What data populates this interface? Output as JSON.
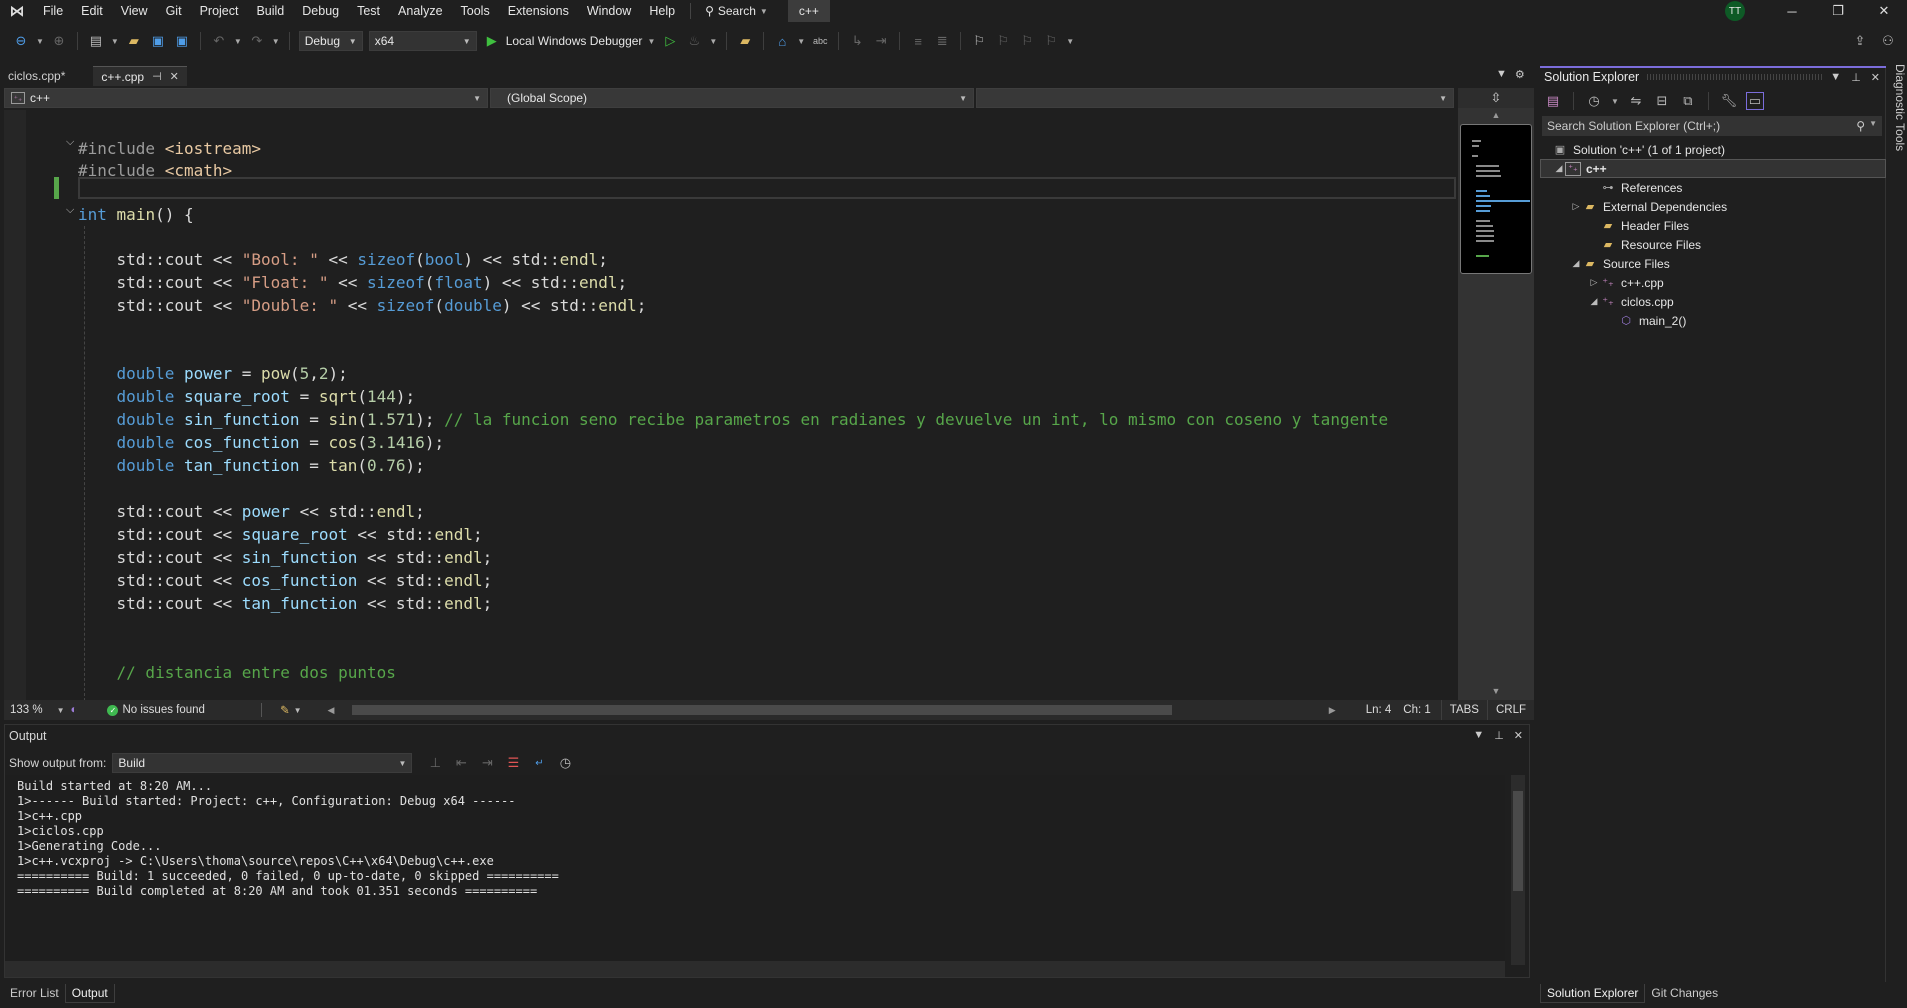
{
  "menubar": {
    "items": [
      "File",
      "Edit",
      "View",
      "Git",
      "Project",
      "Build",
      "Debug",
      "Test",
      "Analyze",
      "Tools",
      "Extensions",
      "Window",
      "Help"
    ],
    "search_label": "Search",
    "solution_name": "c++",
    "avatar_initials": "TT"
  },
  "toolbar": {
    "configuration": "Debug",
    "platform": "x64",
    "debugger_label": "Local Windows Debugger"
  },
  "doc_tabs": [
    {
      "label": "ciclos.cpp*",
      "active": false
    },
    {
      "label": "c++.cpp",
      "active": true
    }
  ],
  "navbar": {
    "project": "c++",
    "scope": "(Global Scope)",
    "member": ""
  },
  "editor": {
    "lines": [
      "#include <iostream>",
      "#include <cmath>",
      "",
      "int main() {",
      "",
      "    std::cout << \"Bool: \" << sizeof(bool) << std::endl;",
      "    std::cout << \"Float: \" << sizeof(float) << std::endl;",
      "    std::cout << \"Double: \" << sizeof(double) << std::endl;",
      "",
      "",
      "    double power = pow(5,2);",
      "    double square_root = sqrt(144);",
      "    double sin_function = sin(1.571); // la funcion seno recibe parametros en radianes y devuelve un int, lo mismo con coseno y tangente",
      "    double cos_function = cos(3.1416);",
      "    double tan_function = tan(0.76);",
      "",
      "    std::cout << power << std::endl;",
      "    std::cout << square_root << std::endl;",
      "    std::cout << sin_function << std::endl;",
      "    std::cout << cos_function << std::endl;",
      "    std::cout << tan_function << std::endl;",
      "",
      "",
      "    // distancia entre dos puntos"
    ]
  },
  "status": {
    "zoom": "133 %",
    "issues": "No issues found",
    "line": "Ln: 4",
    "col": "Ch: 1",
    "indent": "TABS",
    "eol": "CRLF"
  },
  "output": {
    "title": "Output",
    "show_from_label": "Show output from:",
    "source": "Build",
    "lines": [
      "Build started at 8:20 AM...",
      "1>------ Build started: Project: c++, Configuration: Debug x64 ------",
      "1>c++.cpp",
      "1>ciclos.cpp",
      "1>Generating Code...",
      "1>c++.vcxproj -> C:\\Users\\thoma\\source\\repos\\C++\\x64\\Debug\\c++.exe",
      "========== Build: 1 succeeded, 0 failed, 0 up-to-date, 0 skipped ==========",
      "========== Build completed at 8:20 AM and took 01.351 seconds =========="
    ]
  },
  "bottom_tabs": [
    {
      "label": "Error List",
      "active": false
    },
    {
      "label": "Output",
      "active": true
    }
  ],
  "solution_explorer": {
    "title": "Solution Explorer",
    "search_placeholder": "Search Solution Explorer (Ctrl+;)",
    "tree": [
      {
        "label": "Solution 'c++' (1 of 1 project)",
        "level": 0,
        "icon": "solution",
        "expander": ""
      },
      {
        "label": "c++",
        "level": 0,
        "icon": "project",
        "expander": "expanded",
        "selected": true
      },
      {
        "label": "References",
        "level": 2,
        "icon": "references",
        "expander": ""
      },
      {
        "label": "External Dependencies",
        "level": 1,
        "icon": "ext-folder",
        "expander": "collapsed"
      },
      {
        "label": "Header Files",
        "level": 2,
        "icon": "filter-folder",
        "expander": ""
      },
      {
        "label": "Resource Files",
        "level": 2,
        "icon": "filter-folder",
        "expander": ""
      },
      {
        "label": "Source Files",
        "level": 1,
        "icon": "filter-folder",
        "expander": "expanded"
      },
      {
        "label": "c++.cpp",
        "level": 2,
        "icon": "cpp-file",
        "expander": "collapsed"
      },
      {
        "label": "ciclos.cpp",
        "level": 2,
        "icon": "cpp-file",
        "expander": "expanded"
      },
      {
        "label": "main_2()",
        "level": 3,
        "icon": "method",
        "expander": ""
      }
    ]
  },
  "side_tabs": [
    {
      "label": "Solution Explorer",
      "active": true
    },
    {
      "label": "Git Changes",
      "active": false
    }
  ],
  "diagnostic_tools_label": "Diagnostic Tools",
  "colors": {
    "accent": "#7b6ddb",
    "keyword": "#569cd6",
    "function": "#dcdcaa",
    "variable": "#9cdcfe",
    "string": "#d69d85",
    "comment": "#57a64a",
    "number": "#b5cea8"
  }
}
